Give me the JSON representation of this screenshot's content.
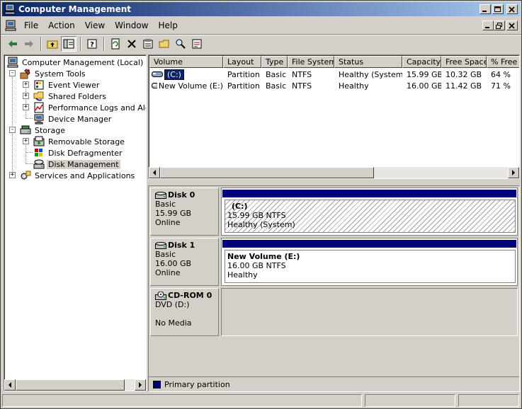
{
  "window": {
    "title": "Computer Management"
  },
  "menu": {
    "items": [
      "File",
      "Action",
      "View",
      "Window",
      "Help"
    ]
  },
  "tree": {
    "root": "Computer Management (Local)",
    "system_tools": "System Tools",
    "event_viewer": "Event Viewer",
    "shared_folders": "Shared Folders",
    "perf_logs": "Performance Logs and Alerts",
    "device_manager": "Device Manager",
    "storage": "Storage",
    "removable_storage": "Removable Storage",
    "disk_defrag": "Disk Defragmenter",
    "disk_mgmt": "Disk Management",
    "services": "Services and Applications"
  },
  "list": {
    "columns": [
      "Volume",
      "Layout",
      "Type",
      "File System",
      "Status",
      "Capacity",
      "Free Space",
      "% Free"
    ],
    "rows": [
      {
        "volume": "(C:)",
        "layout": "Partition",
        "type": "Basic",
        "fs": "NTFS",
        "status": "Healthy (System)",
        "capacity": "15.99 GB",
        "free": "10.32 GB",
        "pct": "64 %"
      },
      {
        "volume": "New Volume (E:)",
        "layout": "Partition",
        "type": "Basic",
        "fs": "NTFS",
        "status": "Healthy",
        "capacity": "16.00 GB",
        "free": "11.42 GB",
        "pct": "71 %"
      }
    ]
  },
  "disks": [
    {
      "name": "Disk 0",
      "type": "Basic",
      "size": "15.99 GB",
      "state": "Online",
      "vol_name": "(C:)",
      "vol_size": "15.99 GB NTFS",
      "vol_status": "Healthy (System)"
    },
    {
      "name": "Disk 1",
      "type": "Basic",
      "size": "16.00 GB",
      "state": "Online",
      "vol_name": "New Volume  (E:)",
      "vol_size": "16.00 GB NTFS",
      "vol_status": "Healthy"
    },
    {
      "name": "CD-ROM 0",
      "type": "DVD (D:)",
      "state": "No Media"
    }
  ],
  "legend": {
    "primary": "Primary partition",
    "primary_color": "#00007f"
  },
  "colors": {
    "titlebar_start": "#0a246a",
    "titlebar_end": "#a6caf0",
    "face": "#d4d0c8"
  }
}
